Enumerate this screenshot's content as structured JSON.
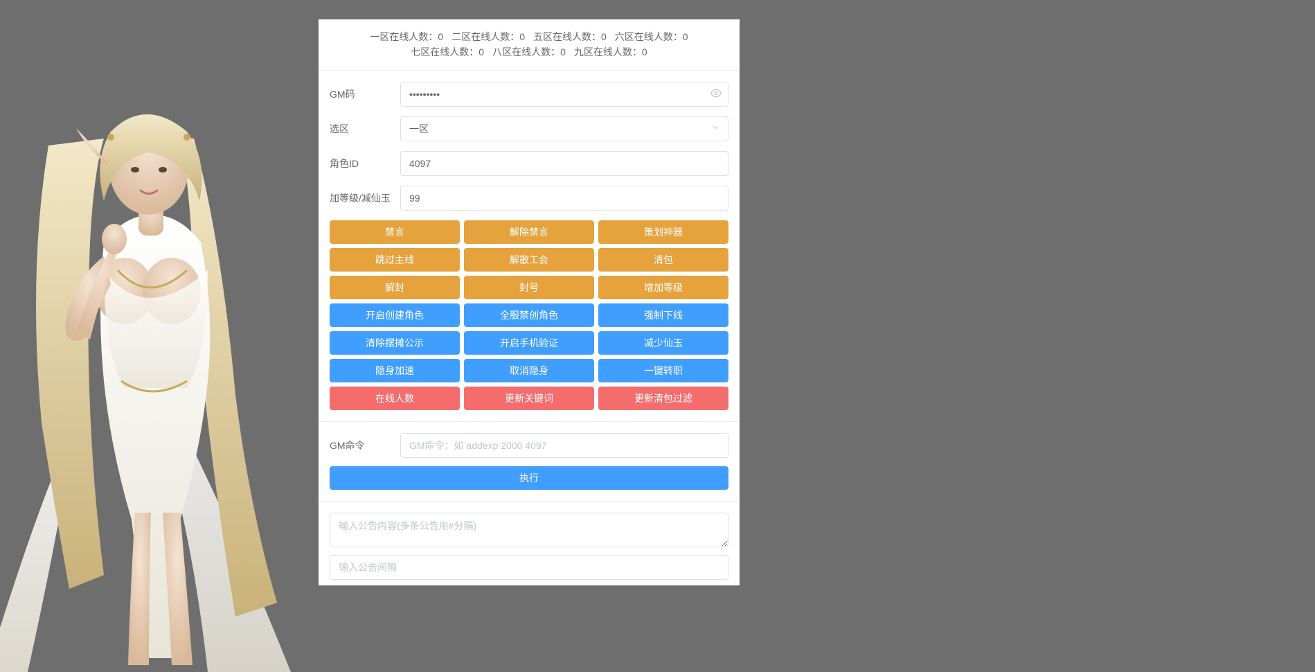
{
  "stats": [
    {
      "label": "一区在线人数：",
      "value": "0"
    },
    {
      "label": "二区在线人数：",
      "value": "0"
    },
    {
      "label": "五区在线人数：",
      "value": "0"
    },
    {
      "label": "六区在线人数：",
      "value": "0"
    },
    {
      "label": "七区在线人数：",
      "value": "0"
    },
    {
      "label": "八区在线人数：",
      "value": "0"
    },
    {
      "label": "九区在线人数：",
      "value": "0"
    }
  ],
  "form": {
    "gm_code_label": "GM码",
    "gm_code_value": "•••••••••",
    "zone_label": "选区",
    "zone_value": "一区",
    "role_id_label": "角色ID",
    "role_id_value": "4097",
    "level_label": "加等级/减仙玉",
    "level_value": "99"
  },
  "buttons": {
    "orange": [
      "禁言",
      "解除禁言",
      "策划神器",
      "跳过主线",
      "解散工会",
      "清包",
      "解封",
      "封号",
      "增加等级"
    ],
    "blue": [
      "开启创建角色",
      "全服禁创角色",
      "强制下线",
      "清除摆摊公示",
      "开启手机验证",
      "减少仙玉",
      "隐身加速",
      "取消隐身",
      "一键转职"
    ],
    "red": [
      "在线人数",
      "更新关键词",
      "更新清包过滤"
    ]
  },
  "cmd": {
    "label": "GM命令",
    "placeholder": "GM命令：如 addexp 2000 4097",
    "exec": "执行"
  },
  "ann": {
    "content_placeholder": "输入公告内容(多条公告用#分隔)",
    "interval_placeholder": "输入公告间隔"
  }
}
